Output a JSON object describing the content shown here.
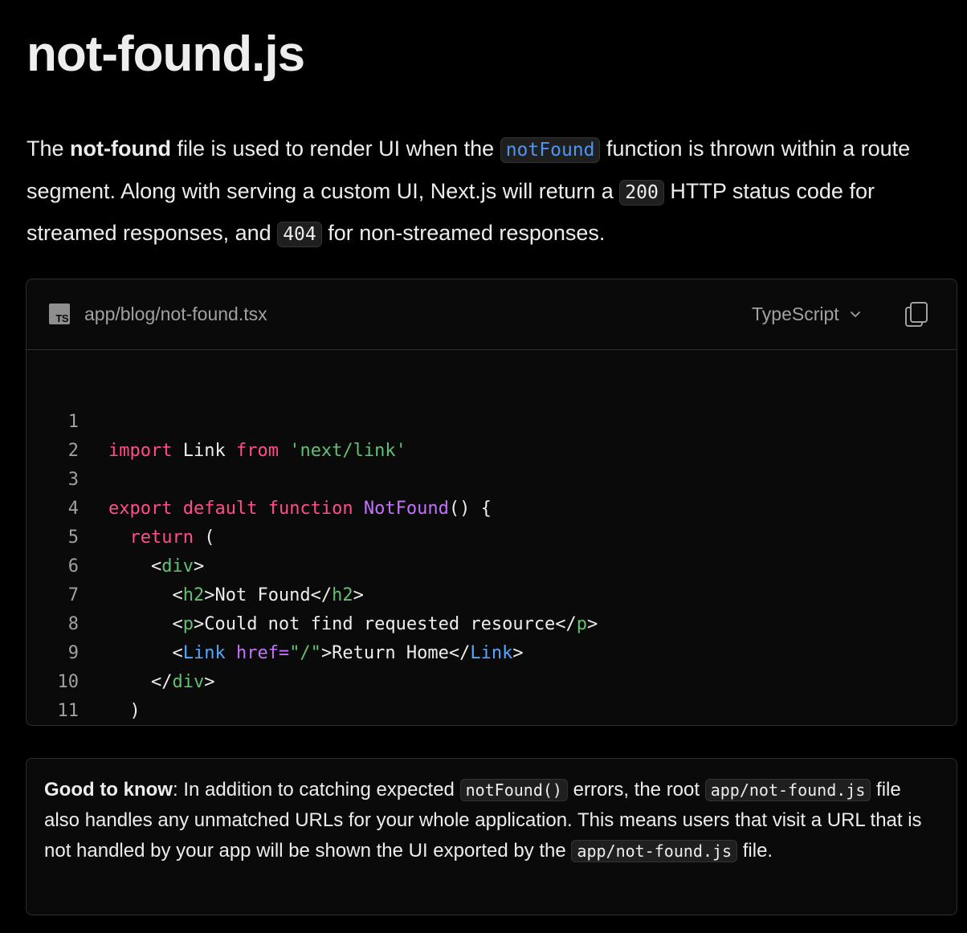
{
  "page": {
    "title": "not-found.js"
  },
  "intro": {
    "p1": "The ",
    "bold": "not-found",
    "p2": " file is used to render UI when the ",
    "code1": "notFound",
    "p3": " function is thrown within a route segment. Along with serving a custom UI, Next.js will return a ",
    "code2": "200",
    "p4": " HTTP status code for streamed responses, and ",
    "code3": "404",
    "p5": " for non-streamed responses."
  },
  "code_block": {
    "file_icon": "TS",
    "filename": "app/blog/not-found.tsx",
    "language": "TypeScript",
    "chevron_icon": "chevron-down-icon",
    "copy_icon": "copy-icon",
    "line_numbers": [
      "1",
      "2",
      "3",
      "4",
      "5",
      "6",
      "7",
      "8",
      "9",
      "10",
      "11"
    ],
    "tokens": {
      "l1_import": "import",
      "l1_link": " Link ",
      "l1_from": "from",
      "l1_str": " 'next/link'",
      "l3_export": "export",
      "l3_default": " default",
      "l3_function": " function",
      "l3_name": " NotFound",
      "l3_rest": "() {",
      "l4_return": "  return",
      "l4_rest": " (",
      "l5_open": "    <",
      "l5_tag": "div",
      "l5_close": ">",
      "l6_open": "      <",
      "l6_tag": "h2",
      "l6_mid": ">Not Found</",
      "l6_tag2": "h2",
      "l6_close": ">",
      "l7_open": "      <",
      "l7_tag": "p",
      "l7_mid": ">Could not find requested resource</",
      "l7_tag2": "p",
      "l7_close": ">",
      "l8_open": "      <",
      "l8_comp": "Link",
      "l8_attr": " href=",
      "l8_str": "\"/\"",
      "l8_mid": ">Return Home</",
      "l8_comp2": "Link",
      "l8_close": ">",
      "l9_open": "    </",
      "l9_tag": "div",
      "l9_close": ">",
      "l10": "  )",
      "l11": "}"
    }
  },
  "note": {
    "label": "Good to know",
    "t1": ": In addition to catching expected ",
    "code1": "notFound()",
    "t2": " errors, the root ",
    "code2": "app/not-found.js",
    "t3": " file also handles any unmatched URLs for your whole application. This means users that visit a URL that is not handled by your app will be shown the UI exported by the ",
    "code3": "app/not-found.js",
    "t4": " file."
  }
}
